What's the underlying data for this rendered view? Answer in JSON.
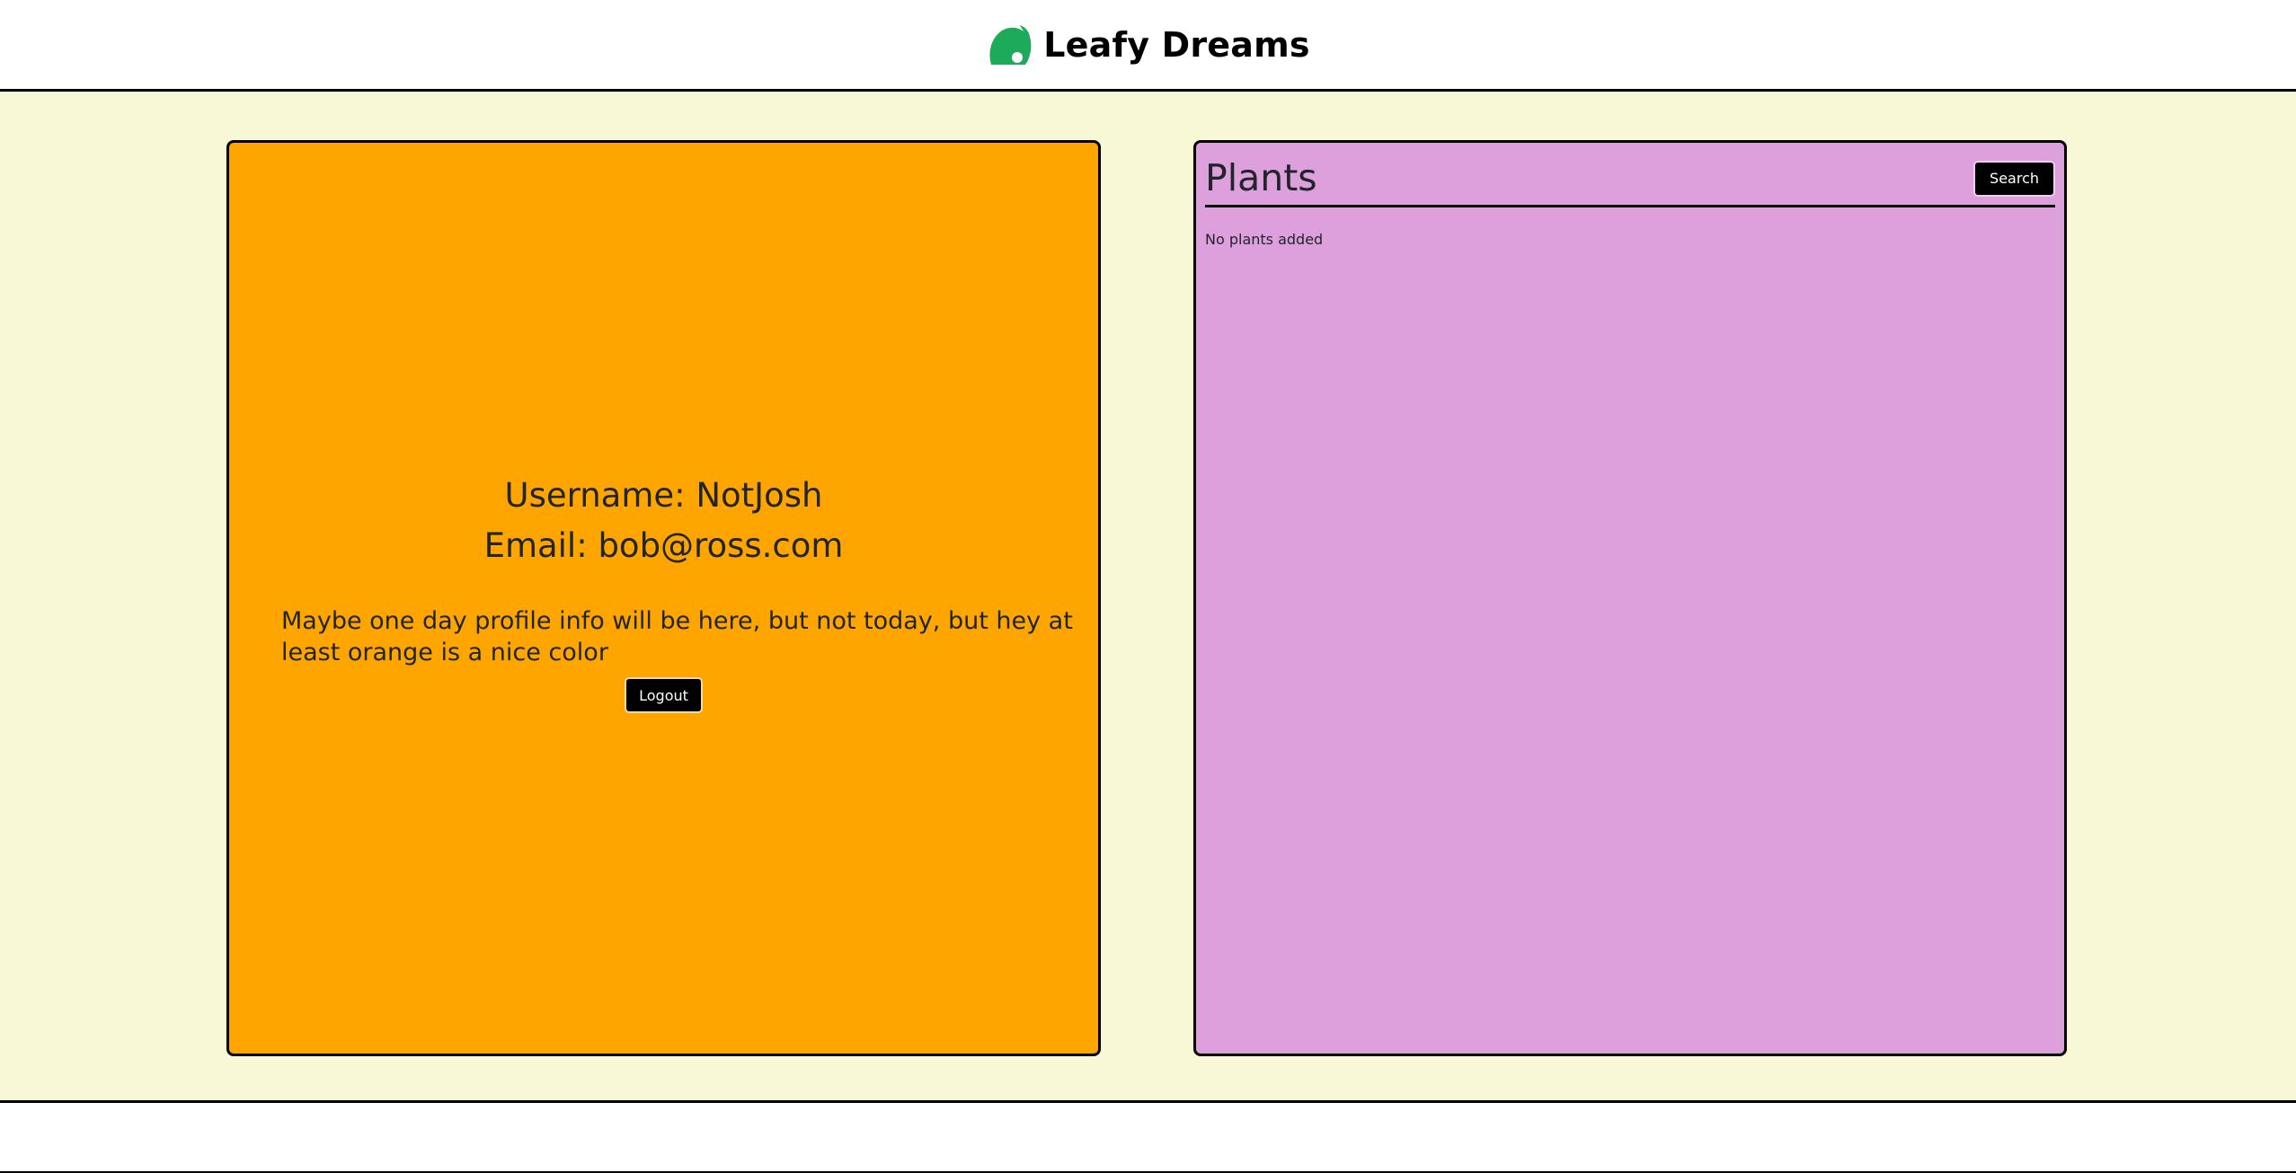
{
  "header": {
    "app_name": "Leafy Dreams",
    "logo_icon": "leaf-icon",
    "logo_color": "#1daa5a"
  },
  "profile": {
    "username_line": "Username: NotJosh",
    "email_line": "Email: bob@ross.com",
    "note": "Maybe one day profile info will be here, but not today, but hey at least orange is a nice color",
    "logout_label": "Logout",
    "card_color": "#ffa500"
  },
  "plants": {
    "title": "Plants",
    "search_label": "Search",
    "empty_text": "No plants added",
    "card_color": "#dda0dd"
  },
  "colors": {
    "page_background": "#f8f8d6",
    "button_background": "#000000"
  }
}
